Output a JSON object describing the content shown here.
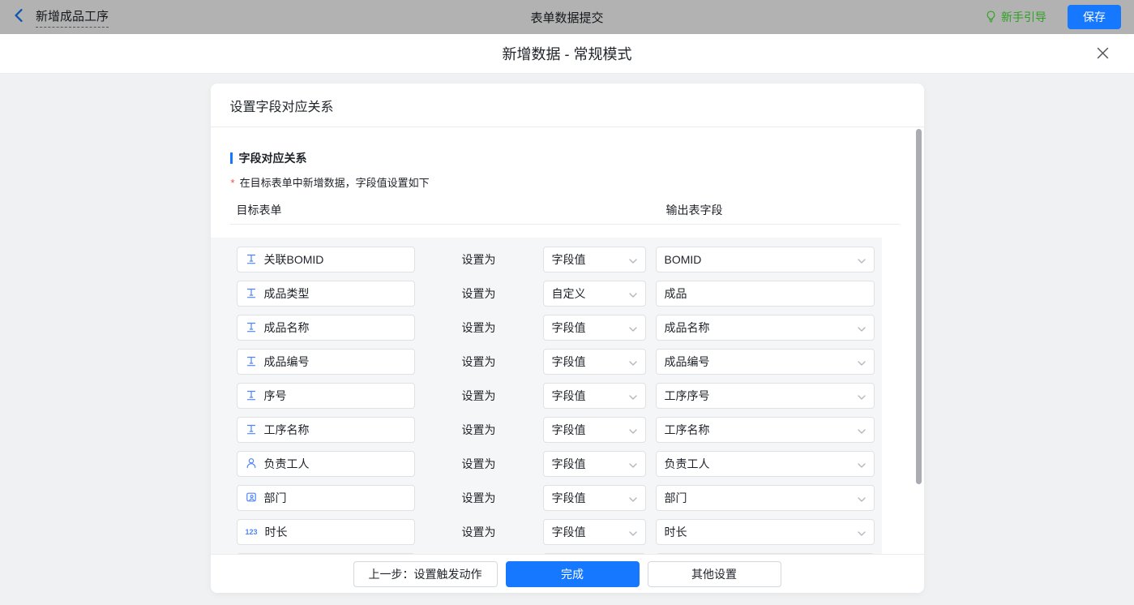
{
  "topbar": {
    "back_label": "新增成品工序",
    "center_title": "表单数据提交",
    "guide_label": "新手引导",
    "save_label": "保存"
  },
  "modal": {
    "title": "新增数据 - 常规模式"
  },
  "card": {
    "header_title": "设置字段对应关系",
    "section_title": "字段对应关系",
    "note": "在目标表单中新增数据，字段值设置如下",
    "columns": {
      "target": "目标表单",
      "output": "输出表字段"
    },
    "set_as_label": "设置为",
    "rows": [
      {
        "target": "关联BOMID",
        "icon": "text-field-icon",
        "mode": "字段值",
        "output": "BOMID",
        "output_type": "select"
      },
      {
        "target": "成品类型",
        "icon": "text-field-icon",
        "mode": "自定义",
        "output": "成品",
        "output_type": "input"
      },
      {
        "target": "成品名称",
        "icon": "text-field-icon",
        "mode": "字段值",
        "output": "成品名称",
        "output_type": "select"
      },
      {
        "target": "成品编号",
        "icon": "text-field-icon",
        "mode": "字段值",
        "output": "成品编号",
        "output_type": "select"
      },
      {
        "target": "序号",
        "icon": "text-field-icon",
        "mode": "字段值",
        "output": "工序序号",
        "output_type": "select"
      },
      {
        "target": "工序名称",
        "icon": "text-field-icon",
        "mode": "字段值",
        "output": "工序名称",
        "output_type": "select"
      },
      {
        "target": "负责工人",
        "icon": "member-icon",
        "mode": "字段值",
        "output": "负责工人",
        "output_type": "select"
      },
      {
        "target": "部门",
        "icon": "department-icon",
        "mode": "字段值",
        "output": "部门",
        "output_type": "select"
      },
      {
        "target": "时长",
        "icon": "number-icon",
        "mode": "字段值",
        "output": "时长",
        "output_type": "select"
      },
      {
        "target": "",
        "icon": "",
        "mode": "",
        "output": "",
        "output_type": "select"
      }
    ],
    "number_icon_text": "123",
    "footer": {
      "prev_label": "上一步：设置触发动作",
      "done_label": "完成",
      "other_label": "其他设置"
    }
  },
  "colors": {
    "primary_blue": "#1677ff",
    "guide_green": "#2ea121",
    "required_red": "#f54a45",
    "field_icon_blue": "#4e83fd"
  }
}
